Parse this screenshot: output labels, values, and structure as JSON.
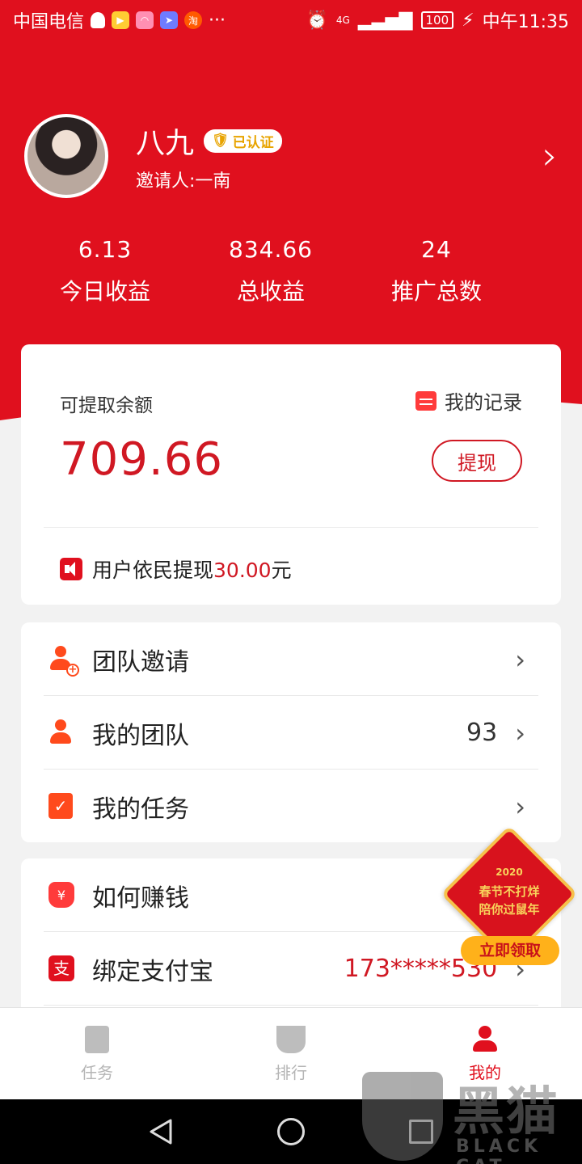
{
  "status_bar": {
    "carrier": "中国电信",
    "app_icon_text": "淘",
    "more": "···",
    "network": "4G",
    "battery": "100",
    "time": "中午11:35"
  },
  "profile": {
    "name": "八九",
    "badge": "已认证",
    "inviter": "邀请人:一南"
  },
  "stats": [
    {
      "value": "6.13",
      "label": "今日收益"
    },
    {
      "value": "834.66",
      "label": "总收益"
    },
    {
      "value": "24",
      "label": "推广总数"
    }
  ],
  "balance": {
    "label": "可提取余额",
    "records_label": "我的记录",
    "amount": "709.66",
    "withdraw_label": "提现",
    "notice_prefix": "用户依民提现",
    "notice_amount": "30.00",
    "notice_suffix": "元"
  },
  "menu1": [
    {
      "label": "团队邀请",
      "value": ""
    },
    {
      "label": "我的团队",
      "value": "93"
    },
    {
      "label": "我的任务",
      "value": ""
    }
  ],
  "menu2": [
    {
      "label": "如何赚钱",
      "value": ""
    },
    {
      "label": "绑定支付宝",
      "value": "173*****530"
    }
  ],
  "promo": {
    "year": "2020",
    "line1": "春节不打烊",
    "line2": "陪你过鼠年",
    "button": "立即领取"
  },
  "tabs": [
    {
      "label": "任务",
      "active": false
    },
    {
      "label": "排行",
      "active": false
    },
    {
      "label": "我的",
      "active": true
    }
  ],
  "watermark": {
    "title": "黑猫",
    "subtitle": "BLACK CAT"
  },
  "colors": {
    "brand_red": "#e0101e",
    "amount_red": "#d01823",
    "accent_orange": "#ff4a1c",
    "promo_gold": "#ffb11a"
  }
}
